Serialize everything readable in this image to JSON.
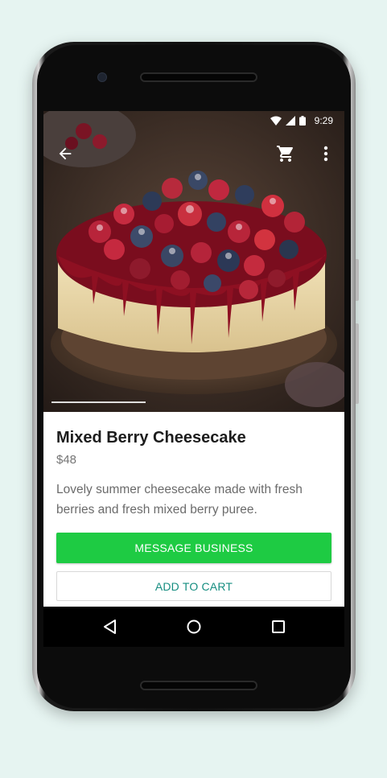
{
  "status_bar": {
    "time": "9:29",
    "icons": [
      "wifi-icon",
      "cell-signal-icon",
      "battery-icon"
    ]
  },
  "app_bar": {
    "icons": [
      "arrow-back-icon",
      "shopping-cart-icon",
      "more-vert-icon"
    ]
  },
  "product": {
    "image_description": "berry-cheesecake-photo",
    "image_slide_progress": 0.33,
    "title": "Mixed Berry Cheesecake",
    "price": "$48",
    "description": "Lovely summer cheesecake made with fresh berries and fresh mixed berry puree."
  },
  "actions": {
    "message_label": "MESSAGE BUSINESS",
    "cart_label": "ADD TO CART"
  },
  "nav_bar": {
    "icons": [
      "nav-back-icon",
      "nav-home-icon",
      "nav-recents-icon"
    ]
  },
  "colors": {
    "primary_button": "#1ecb43",
    "secondary_text": "#158d80",
    "background": "#e6f4f1"
  }
}
